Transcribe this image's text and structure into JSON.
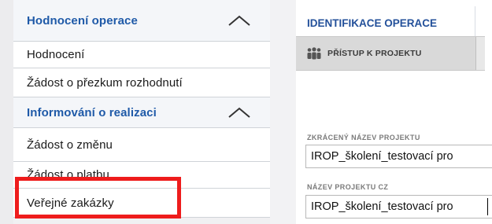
{
  "sidebar": {
    "items": [
      {
        "label": "Hodnocení operace",
        "type": "section",
        "expanded": true
      },
      {
        "label": "Hodnocení",
        "type": "item"
      },
      {
        "label": "Žádost o přezkum rozhodnutí",
        "type": "item"
      },
      {
        "label": "Informování o realizaci",
        "type": "section",
        "expanded": true
      },
      {
        "label": "Žádost o změnu",
        "type": "item"
      },
      {
        "label": "Žádost o platbu",
        "type": "item"
      },
      {
        "label": "Veřejné zakázky",
        "type": "item",
        "highlighted": true
      }
    ]
  },
  "panel": {
    "title": "IDENTIFIKACE OPERACE",
    "tab": {
      "label": "PŘÍSTUP K PROJEKTU",
      "icon": "people-icon"
    },
    "fields": [
      {
        "label": "ZKRÁCENÝ NÁZEV PROJEKTU",
        "value": "IROP_školení_testovací pro"
      },
      {
        "label": "NÁZEV PROJEKTU CZ",
        "value": "IROP_školení_testovací pro"
      }
    ]
  },
  "colors": {
    "section_text": "#1f5aa8",
    "panel_title": "#23509a",
    "highlight": "#ee1c1c"
  }
}
